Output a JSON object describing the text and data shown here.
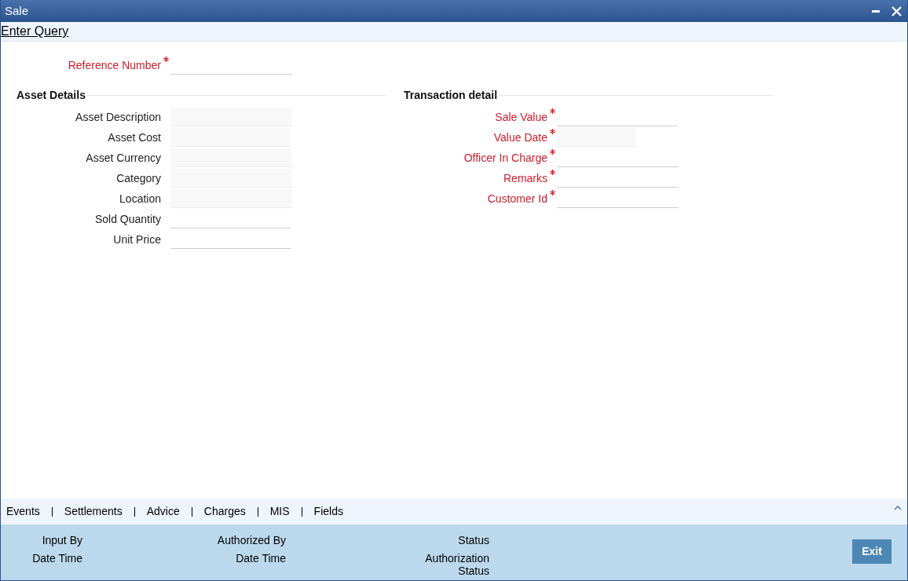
{
  "window": {
    "title": "Sale"
  },
  "query_link": "Enter Query",
  "reference": {
    "label": "Reference Number",
    "required": true,
    "kind": "input"
  },
  "asset_details": {
    "title": "Asset Details",
    "fields": [
      {
        "label": "Asset Description",
        "required": false,
        "kind": "readonly"
      },
      {
        "label": "Asset Cost",
        "required": false,
        "kind": "readonly"
      },
      {
        "label": "Asset Currency",
        "required": false,
        "kind": "readonly"
      },
      {
        "label": "Category",
        "required": false,
        "kind": "readonly"
      },
      {
        "label": "Location",
        "required": false,
        "kind": "readonly"
      },
      {
        "label": "Sold Quantity",
        "required": false,
        "kind": "input"
      },
      {
        "label": "Unit Price",
        "required": false,
        "kind": "input"
      }
    ]
  },
  "transaction_detail": {
    "title": "Transaction detail",
    "fields": [
      {
        "label": "Sale Value",
        "required": true,
        "kind": "input"
      },
      {
        "label": "Value Date",
        "required": true,
        "kind": "readonly"
      },
      {
        "label": "Officer In Charge",
        "required": true,
        "kind": "input"
      },
      {
        "label": "Remarks",
        "required": true,
        "kind": "input"
      },
      {
        "label": "Customer Id",
        "required": true,
        "kind": "input"
      }
    ]
  },
  "subsystem_tabs": [
    "Events",
    "Settlements",
    "Advice",
    "Charges",
    "MIS",
    "Fields"
  ],
  "audit": [
    {
      "label": "Input By"
    },
    {
      "label": "Authorized By"
    },
    {
      "label": "Status"
    },
    {
      "label": "Date Time"
    },
    {
      "label": "Date Time"
    },
    {
      "label": "Authorization Status"
    }
  ],
  "buttons": [
    "Exit"
  ]
}
